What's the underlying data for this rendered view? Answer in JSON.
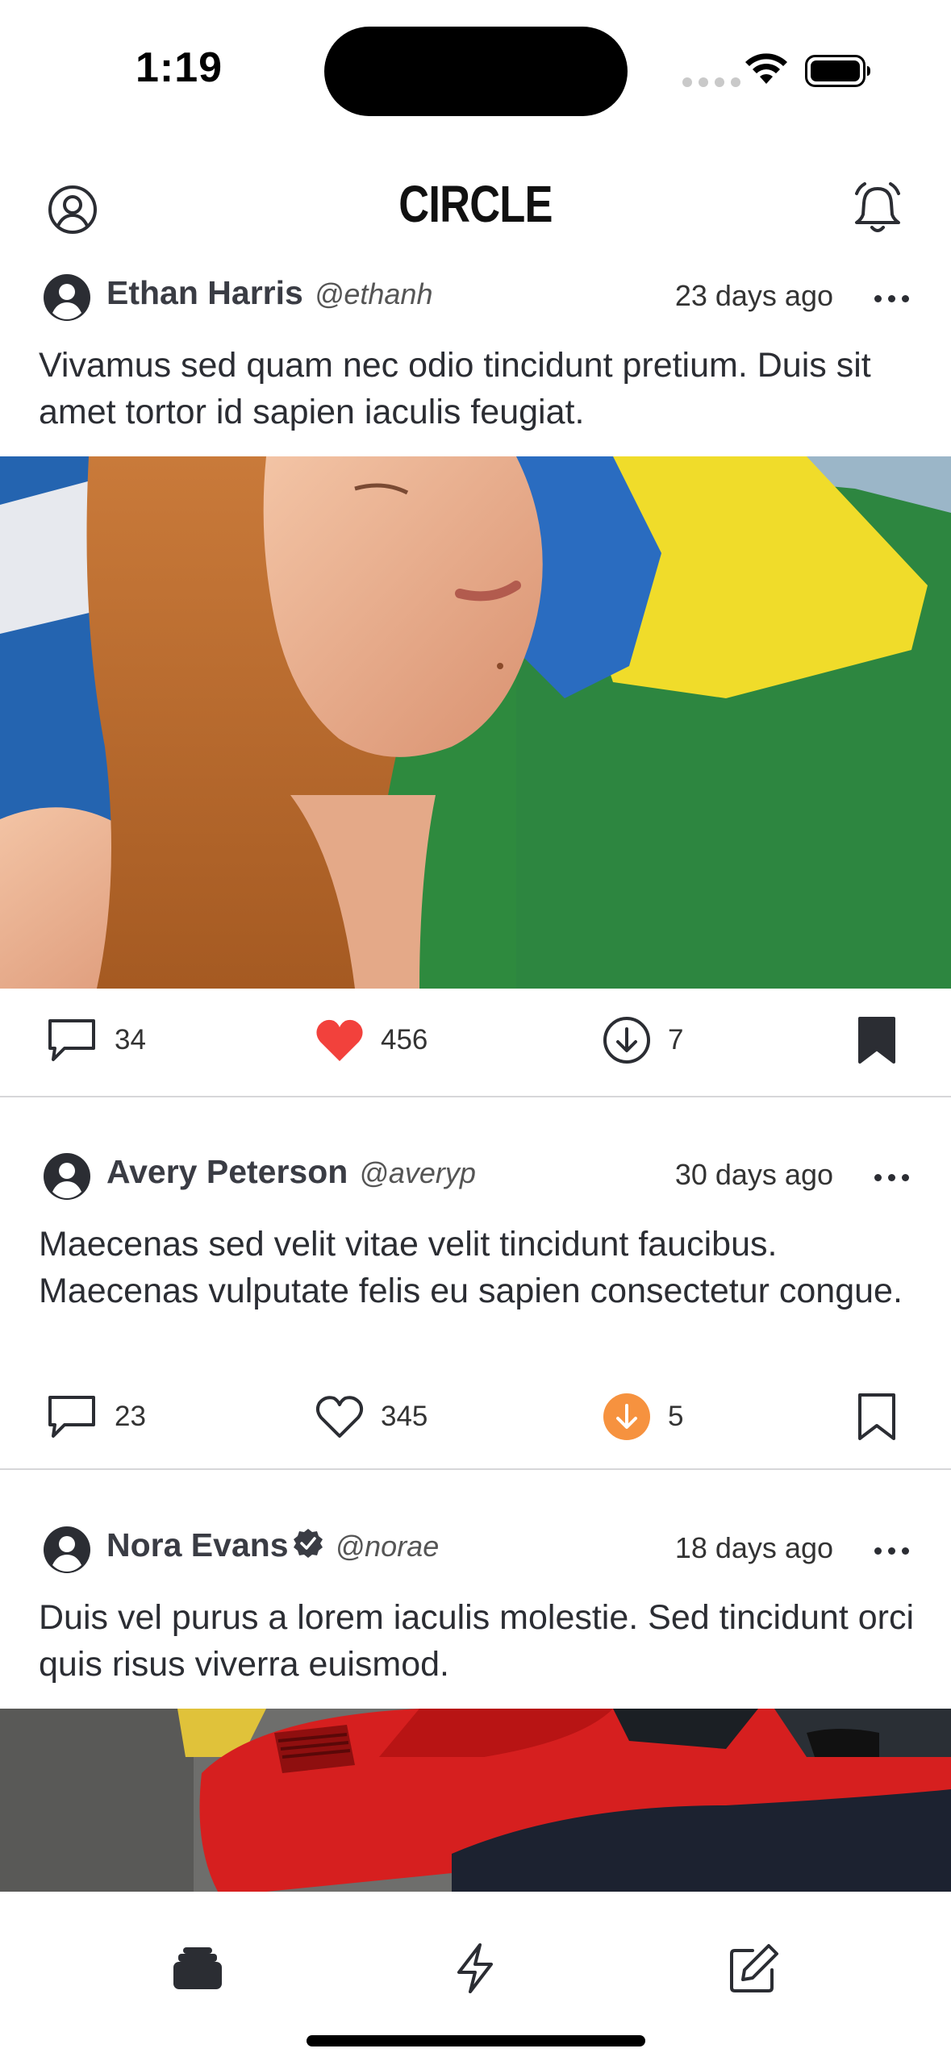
{
  "status_bar": {
    "time": "1:19"
  },
  "header": {
    "title": "CIRCLE"
  },
  "posts": [
    {
      "author": "Ethan Harris",
      "handle": "@ethanh",
      "time": "23 days ago",
      "text": "Vivamus sed quam nec odio tincidunt pretium. Duis sit amet tortor id sapien iaculis feugiat.",
      "comments": "34",
      "likes": "456",
      "downloads": "7",
      "liked": true,
      "bookmarked": true,
      "image": "woman-with-brazil-flag"
    },
    {
      "author": "Avery Peterson",
      "handle": "@averyp",
      "time": "30 days ago",
      "text": "Maecenas sed velit vitae velit tincidunt faucibus. Maecenas vulputate felis eu sapien consectetur congue.",
      "comments": "23",
      "likes": "345",
      "downloads": "5",
      "downloaded": true
    },
    {
      "author": "Nora Evans",
      "handle": "@norae",
      "time": "18 days ago",
      "text": "Duis vel purus a lorem iaculis molestie. Sed tincidunt orci quis risus viverra euismod.",
      "verified": true,
      "image": "red-sports-car"
    }
  ],
  "tab_bar": {
    "items": [
      "feed-icon",
      "bolt-icon",
      "compose-icon"
    ]
  },
  "colors": {
    "like": "#f2413c",
    "download": "#f6923f",
    "ink": "#2b2d33"
  }
}
